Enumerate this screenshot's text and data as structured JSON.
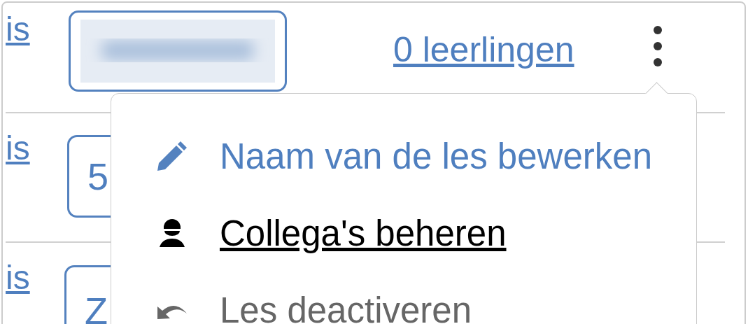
{
  "rows": [
    {
      "link": "is",
      "code": {
        "kind": "blurred"
      },
      "students": "0 leerlingen",
      "menu_open": true
    },
    {
      "link": "is",
      "code": {
        "kind": "text",
        "text": "5"
      }
    },
    {
      "link": "is",
      "code": {
        "kind": "text",
        "text": "Z"
      }
    }
  ],
  "menu": {
    "items": [
      {
        "kind": "edit",
        "label": "Naam van de les bewerken",
        "hovered": false
      },
      {
        "kind": "people",
        "label": "Collega's beheren",
        "hovered": true
      },
      {
        "kind": "undo",
        "label": "Les deactiveren",
        "hovered": false
      }
    ]
  }
}
